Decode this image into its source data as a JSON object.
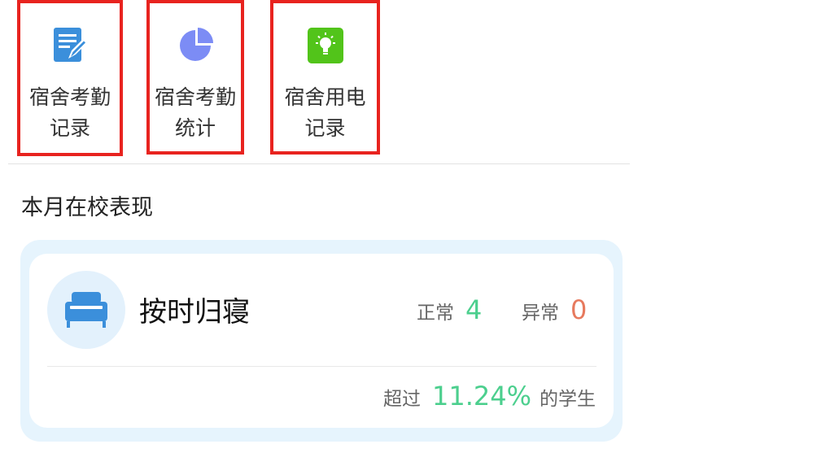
{
  "entries": [
    {
      "label": "宿舍考勤记录",
      "icon": "edit-document-icon",
      "color": "#3b8fdb"
    },
    {
      "label": "宿舍考勤统计",
      "icon": "pie-chart-icon",
      "color": "#7c8cf5"
    },
    {
      "label": "宿舍用电记录",
      "icon": "lightbulb-icon",
      "color": "#52c41a"
    }
  ],
  "section": {
    "title": "本月在校表现"
  },
  "card": {
    "icon": "bed-icon",
    "title": "按时归寝",
    "normal_label": "正常",
    "normal_value": "4",
    "abnormal_label": "异常",
    "abnormal_value": "0",
    "summary_prefix": "超过",
    "summary_percent": "11.24%",
    "summary_suffix": "的学生"
  },
  "colors": {
    "highlight_border": "#e8231f",
    "green": "#4ccf8e",
    "red": "#e77a5e",
    "card_bg": "#e6f4fd"
  }
}
